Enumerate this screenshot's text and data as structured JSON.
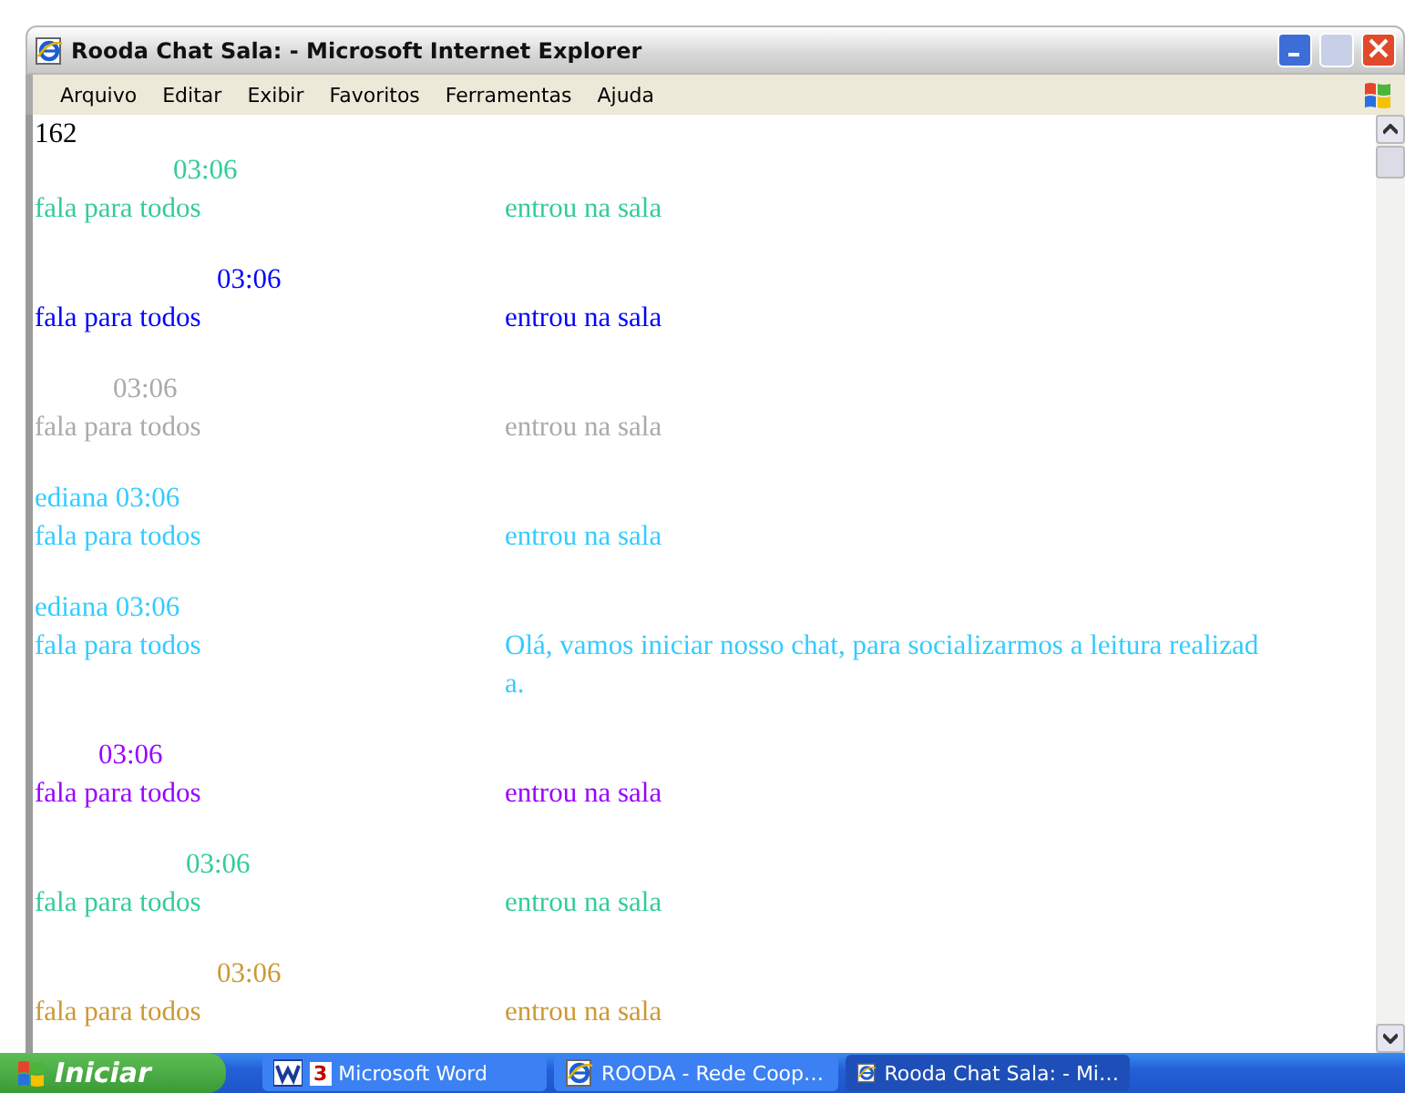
{
  "window": {
    "title": "Rooda Chat Sala: - Microsoft Internet Explorer"
  },
  "menu": [
    "Arquivo",
    "Editar",
    "Exibir",
    "Favoritos",
    "Ferramentas",
    "Ajuda"
  ],
  "counter": "162",
  "messages": [
    {
      "time": "03:06",
      "target": "fala para todos",
      "text": "entrou na sala",
      "color": "#33cc99"
    },
    {
      "time": "03:06",
      "target": "fala para todos",
      "text": "entrou na sala",
      "color": "#0000ff"
    },
    {
      "time": "03:06",
      "target": "fala para todos",
      "text": "entrou na sala",
      "color": "#aaaaaa"
    },
    {
      "author": "ediana",
      "time": "03:06",
      "target": "fala para todos",
      "text": "entrou na sala",
      "color": "#33ccff"
    },
    {
      "author": "ediana",
      "time": "03:06",
      "target": "fala para todos",
      "text": "Olá, vamos iniciar nosso chat, para socializarmos a leitura realizada.",
      "color": "#33ccff"
    },
    {
      "time": "03:06",
      "target": "fala para todos",
      "text": "entrou na sala",
      "color": "#9900ff"
    },
    {
      "time": "03:06",
      "target": "fala para todos",
      "text": "entrou na sala",
      "color": "#33cc99"
    },
    {
      "time": "03:06",
      "target": "fala para todos",
      "text": "entrou na sala",
      "color": "#cc9933"
    }
  ],
  "taskbar": {
    "start": "Iniciar",
    "tasks": [
      {
        "label": "Microsoft Word",
        "count": "3",
        "kind": "word",
        "selected": false
      },
      {
        "label": "ROODA - Rede Coop…",
        "kind": "browser",
        "selected": false
      },
      {
        "label": "Rooda Chat Sala: - Mi…",
        "kind": "browser",
        "selected": true
      }
    ]
  }
}
